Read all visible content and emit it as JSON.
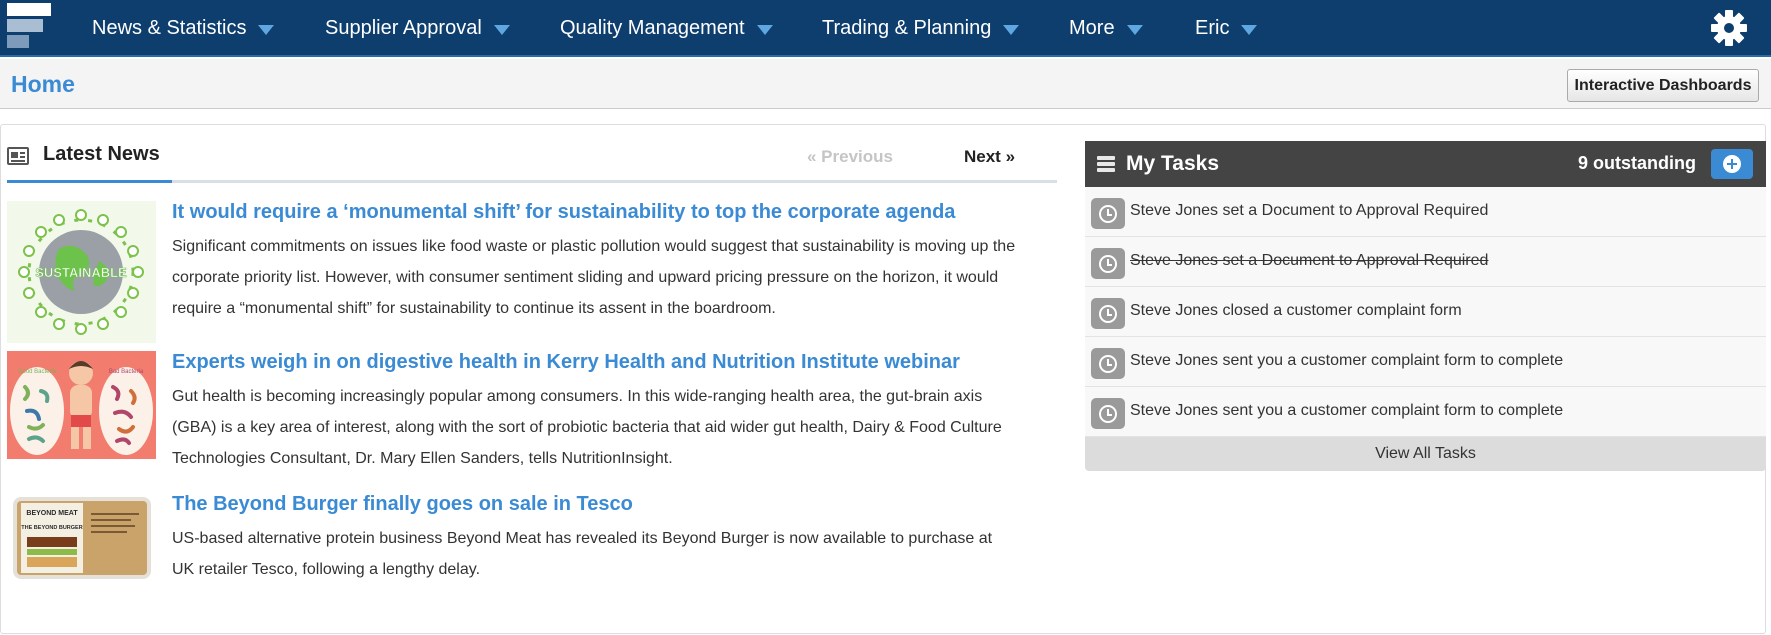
{
  "nav": {
    "items": [
      {
        "label": "News & Statistics"
      },
      {
        "label": "Supplier Approval"
      },
      {
        "label": "Quality Management"
      },
      {
        "label": "Trading & Planning"
      },
      {
        "label": "More"
      },
      {
        "label": "Eric"
      }
    ],
    "settings_icon": "gear-icon"
  },
  "page": {
    "title": "Home",
    "dashboards_button": "Interactive Dashboards"
  },
  "news": {
    "heading": "Latest News",
    "prev_label": "« Previous",
    "next_label": "Next »",
    "articles": [
      {
        "title": "It would require a ‘monumental shift’ for sustainability to top the corporate agenda",
        "body": "Significant commitments on issues like food waste or plastic pollution would suggest that sustainability is moving up the corporate priority list. However, with consumer sentiment sliding and upward pricing pressure on the horizon, it would require a “monumental shift” for sustainability to continue its assent in the boardroom.",
        "thumb_text": "SUSTAINABLE"
      },
      {
        "title": "Experts weigh in on digestive health in Kerry Health and Nutrition Institute webinar",
        "body": "Gut health is becoming increasingly popular among consumers. In this wide-ranging health area, the gut-brain axis (GBA) is a key area of interest, along with the sort of probiotic bacteria that aid wider gut health, Dairy & Food Culture Technologies Consultant, Dr. Mary Ellen Sanders, tells NutritionInsight.",
        "thumb_left": "Good Bacteria",
        "thumb_right": "Bad Bacteria"
      },
      {
        "title": "The Beyond Burger finally goes on sale in Tesco",
        "body": "US-based alternative protein business Beyond Meat has revealed its Beyond Burger is now available to purchase at UK retailer Tesco, following a lengthy delay.",
        "thumb_brand": "BEYOND MEAT",
        "thumb_product": "THE BEYOND BURGER"
      }
    ]
  },
  "tasks": {
    "title": "My Tasks",
    "outstanding": "9 outstanding",
    "items": [
      {
        "text": "Steve Jones set a Document to Approval Required"
      },
      {
        "text": "Steve Jones set a Document to Approval Required"
      },
      {
        "text": "Steve Jones closed a customer complaint form"
      },
      {
        "text": "Steve Jones sent you a customer complaint form to complete"
      },
      {
        "text": "Steve Jones sent you a customer complaint form to complete"
      }
    ],
    "view_all": "View All Tasks"
  },
  "colors": {
    "nav_bg": "#0d3e6e",
    "accent": "#3a8ad4",
    "tasks_header": "#444444"
  }
}
